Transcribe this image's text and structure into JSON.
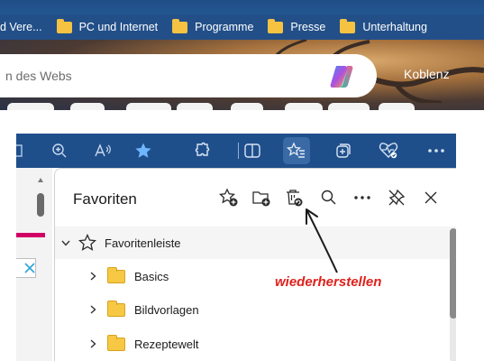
{
  "browser": {
    "favorites_bar": [
      {
        "label": "d Vere..."
      },
      {
        "label": "PC und Internet"
      },
      {
        "label": "Programme"
      },
      {
        "label": "Presse"
      },
      {
        "label": "Unterhaltung"
      }
    ],
    "search": {
      "text": "n des Webs"
    },
    "copilot_icon": "copilot-icon",
    "location": "Koblenz"
  },
  "toolbar": {
    "buttons": [
      "zoom-in-icon",
      "read-aloud-icon",
      "favorites-star-icon",
      "extensions-icon",
      "split-screen-icon",
      "favorites-list-icon",
      "collections-icon",
      "browser-essentials-icon",
      "more-icon"
    ],
    "active": "favorites-list-icon"
  },
  "favorites_panel": {
    "title": "Favoriten",
    "header_buttons": [
      "add-favorite-icon",
      "add-folder-icon",
      "restore-deleted-icon",
      "search-icon",
      "more-options-icon",
      "unpin-icon",
      "close-icon"
    ],
    "items": [
      {
        "label": "Favoritenleiste",
        "level": 0,
        "expanded": true,
        "icon": "star-outline-icon"
      },
      {
        "label": "Basics",
        "level": 1,
        "expanded": false,
        "icon": "folder-icon"
      },
      {
        "label": "Bildvorlagen",
        "level": 1,
        "expanded": false,
        "icon": "folder-icon"
      },
      {
        "label": "Rezeptewelt",
        "level": 1,
        "expanded": false,
        "icon": "folder-icon"
      }
    ]
  },
  "annotation": {
    "text": "wiederherstellen",
    "color": "#e0201b"
  },
  "colors": {
    "toolbar": "#1f4f8b",
    "folder": "#f6c844",
    "accent_pink": "#d20065"
  }
}
